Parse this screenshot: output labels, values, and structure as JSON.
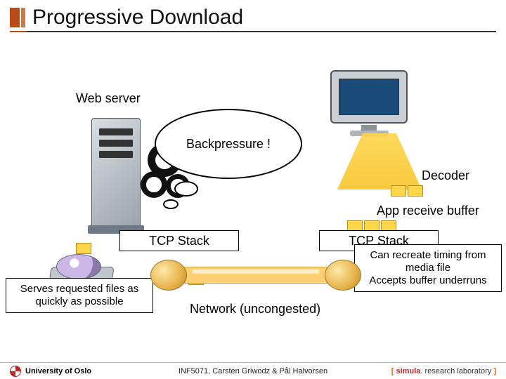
{
  "title": "Progressive Download",
  "labels": {
    "web_server": "Web server",
    "backpressure": "Backpressure !",
    "decoder": "Decoder",
    "app_receive_buffer": "App receive buffer",
    "tcp_stack": "TCP Stack",
    "network": "Network (uncongested)"
  },
  "callouts": {
    "server": "Serves requested files as quickly as possible",
    "client": "Can recreate timing from media file\nAccepts buffer underruns"
  },
  "footer": {
    "left": "University of Oslo",
    "center": "INF5071, Carsten Griwodz & Pål Halvorsen",
    "right_brackets": [
      "[ ",
      " ]"
    ],
    "right_brand": "simula",
    "right_rest": ". research laboratory"
  }
}
